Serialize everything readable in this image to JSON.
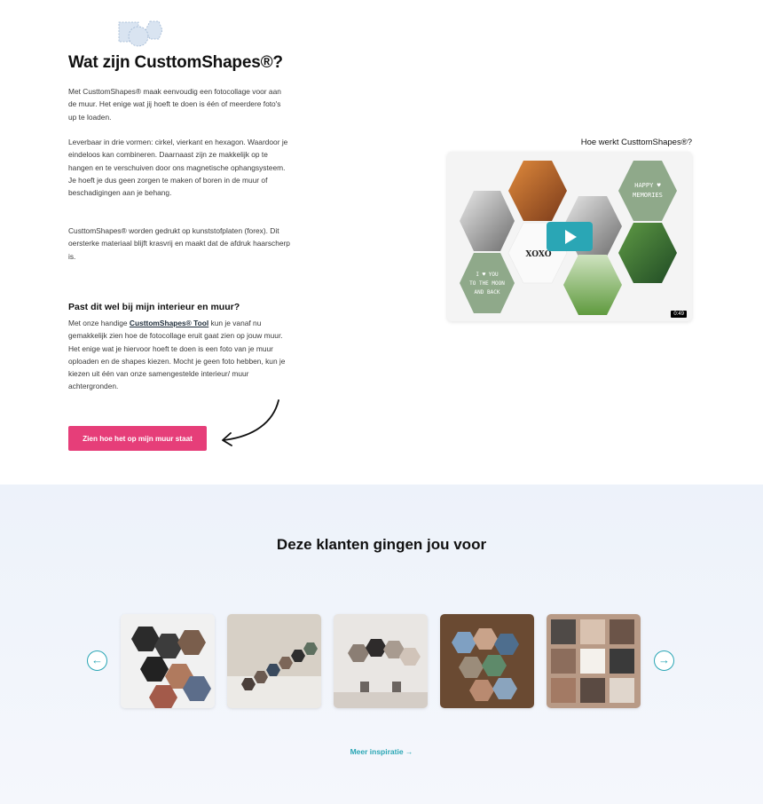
{
  "intro": {
    "heading": "Wat zijn CusttomShapes®?",
    "p1": "Met CusttomShapes® maak eenvoudig een fotocollage voor aan de muur. Het enige wat jij hoeft te doen is één of meerdere foto's up te loaden.",
    "p2": "Leverbaar in drie vormen: cirkel, vierkant en hexagon. Waardoor je eindeloos kan combineren. Daarnaast zijn ze makkelijk op te hangen en te verschuiven door ons magnetische ophangsysteem. Je hoeft je dus geen zorgen te maken of boren in de muur of beschadigingen aan je behang.",
    "p3": "CusttomShapes® worden gedrukt op kunststofplaten (forex). Dit oersterke materiaal blijft krasvrij en maakt dat de afdruk haarscherp is."
  },
  "fit": {
    "heading": "Past dit wel bij mijn interieur en muur?",
    "text_before": "Met onze handige ",
    "tool_link": "CusttomShapes® Tool",
    "text_after": " kun je vanaf nu gemakkelijk zien hoe de fotocollage eruit gaat zien op jouw muur. Het enige wat je hiervoor hoeft te doen is een foto van je muur oploaden en de shapes kiezen. Mocht je geen foto hebben, kun je kiezen uit één van onze samengestelde interieur/ muur achtergronden.",
    "cta": "Zien hoe het op mijn muur staat"
  },
  "video": {
    "title": "Hoe werkt CusttomShapes®?",
    "duration": "0:49",
    "hex1_text": "HAPPY ♥ MEMORIES",
    "hex2_text": "I ♥ YOU TO THE MOON AND BACK",
    "xoxo": "XOXO"
  },
  "customers": {
    "heading": "Deze klanten gingen jou voor",
    "prev": "←",
    "next": "→",
    "thumb1_caption": "lady_fin",
    "more": "Meer inspiratie →"
  },
  "colors": {
    "accent": "#e63e79",
    "teal": "#2aa6b5",
    "sage": "#8fa98a"
  },
  "icons": [
    "shapes-logo-icon",
    "curved-arrow-icon",
    "play-icon",
    "arrow-left-icon",
    "arrow-right-icon"
  ]
}
